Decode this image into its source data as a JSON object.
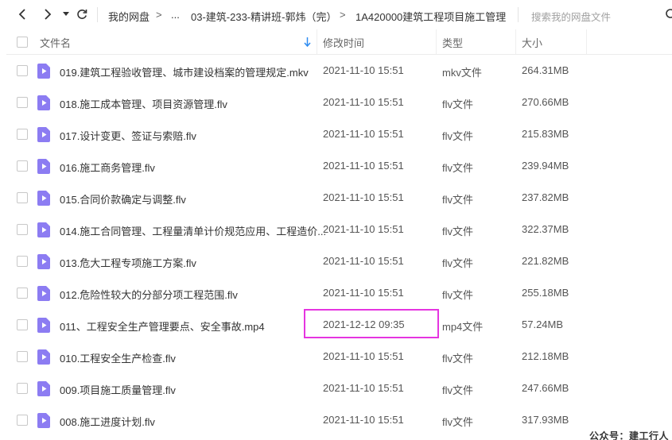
{
  "toolbar": {
    "breadcrumb": [
      "我的网盘",
      "...",
      "03-建筑-233-精讲班-郭炜（完）",
      "1A420000建筑工程项目施工管理"
    ],
    "search_placeholder": "搜索我的网盘文件"
  },
  "header": {
    "name": "文件名",
    "modified": "修改时间",
    "type": "类型",
    "size": "大小"
  },
  "files": [
    {
      "name": "019.建筑工程验收管理、城市建设档案的管理规定.mkv",
      "modified": "2021-11-10 15:51",
      "type": "mkv文件",
      "size": "264.31MB"
    },
    {
      "name": "018.施工成本管理、项目资源管理.flv",
      "modified": "2021-11-10 15:51",
      "type": "flv文件",
      "size": "270.66MB"
    },
    {
      "name": "017.设计变更、签证与索赔.flv",
      "modified": "2021-11-10 15:51",
      "type": "flv文件",
      "size": "215.83MB"
    },
    {
      "name": "016.施工商务管理.flv",
      "modified": "2021-11-10 15:51",
      "type": "flv文件",
      "size": "239.94MB"
    },
    {
      "name": "015.合同价款确定与调整.flv",
      "modified": "2021-11-10 15:51",
      "type": "flv文件",
      "size": "237.82MB"
    },
    {
      "name": "014.施工合同管理、工程量清单计价规范应用、工程造价...",
      "modified": "2021-11-10 15:51",
      "type": "flv文件",
      "size": "322.37MB"
    },
    {
      "name": "013.危大工程专项施工方案.flv",
      "modified": "2021-11-10 15:51",
      "type": "flv文件",
      "size": "221.82MB"
    },
    {
      "name": "012.危险性较大的分部分项工程范围.flv",
      "modified": "2021-11-10 15:51",
      "type": "flv文件",
      "size": "255.18MB"
    },
    {
      "name": "011、工程安全生产管理要点、安全事故.mp4",
      "modified": "2021-12-12 09:35",
      "type": "mp4文件",
      "size": "57.24MB"
    },
    {
      "name": "010.工程安全生产检查.flv",
      "modified": "2021-11-10 15:51",
      "type": "flv文件",
      "size": "212.18MB"
    },
    {
      "name": "009.项目施工质量管理.flv",
      "modified": "2021-11-10 15:51",
      "type": "flv文件",
      "size": "247.66MB"
    },
    {
      "name": "008.施工进度计划.flv",
      "modified": "2021-11-10 15:51",
      "type": "flv文件",
      "size": "317.93MB"
    }
  ],
  "watermark": "公众号：建工行人",
  "icons": {
    "back": "chevron-left-icon",
    "forward": "chevron-right-icon",
    "history": "caret-down-icon",
    "refresh": "refresh-icon",
    "search": "search-icon",
    "sort": "arrow-down-icon",
    "file": "video-file-icon"
  },
  "colors": {
    "accent": "#2f8cf0",
    "file_icon": "#8c7cf2",
    "highlight_box": "#e535e0"
  }
}
